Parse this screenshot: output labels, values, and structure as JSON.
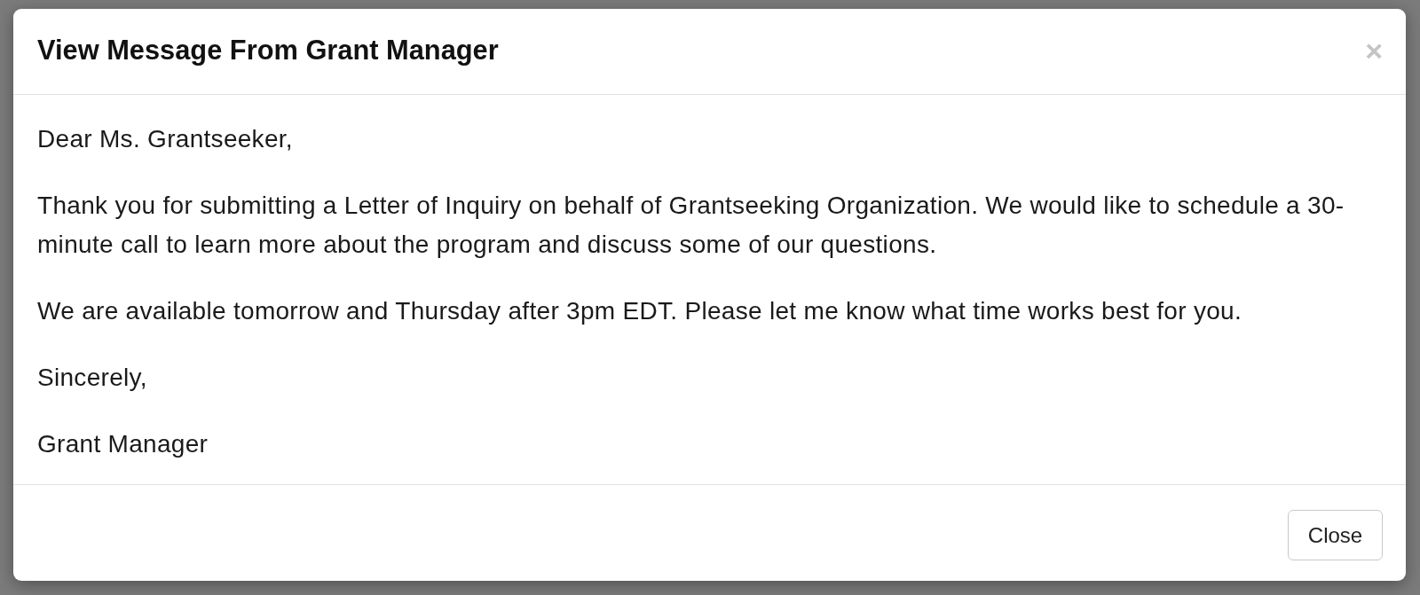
{
  "modal": {
    "title": "View Message From Grant Manager",
    "close_icon": "×",
    "paragraphs": [
      "Dear Ms. Grantseeker,",
      "Thank you for submitting a Letter of Inquiry on behalf of Grantseeking Organization. We would like to schedule a 30-minute call to learn more about the program and discuss some of our questions.",
      "We are available tomorrow and Thursday after 3pm EDT. Please let me know what time works best for you.",
      "Sincerely,",
      "Grant Manager"
    ],
    "buttons": [
      "Close"
    ]
  }
}
